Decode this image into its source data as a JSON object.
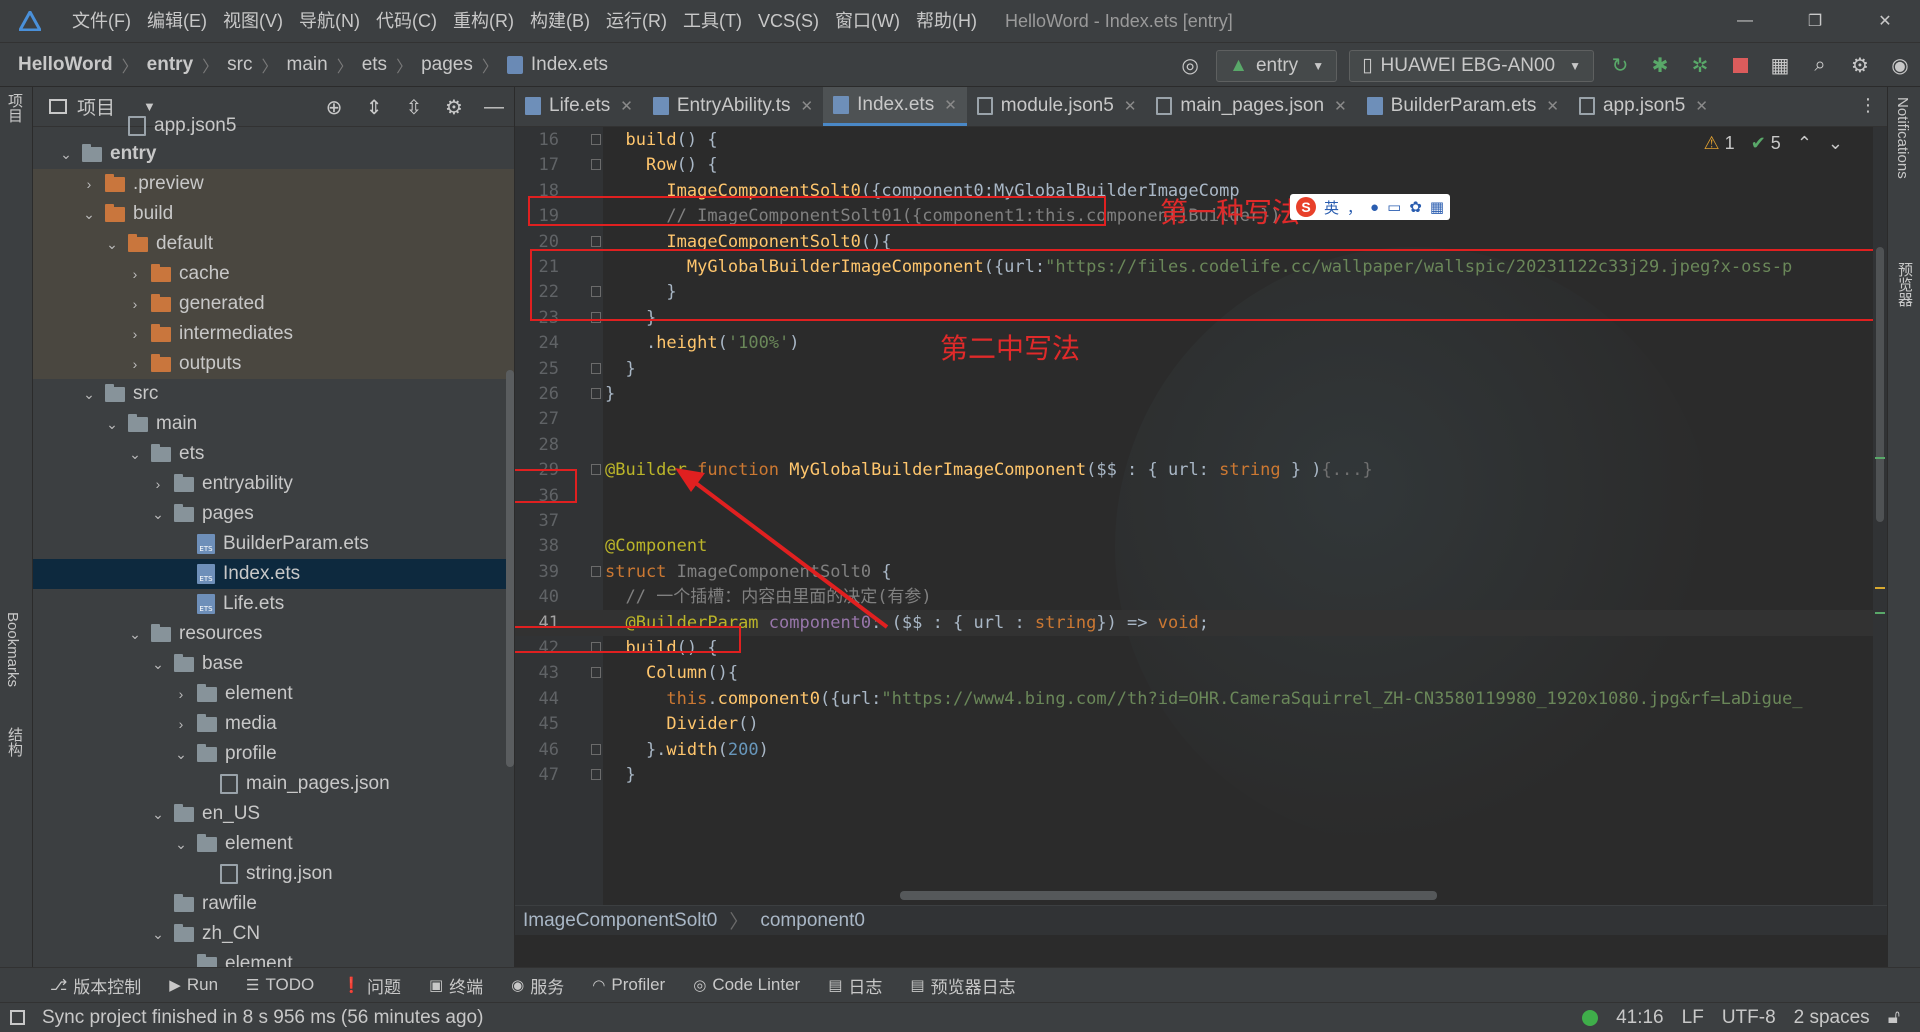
{
  "titlebar": {
    "menu": [
      "文件(F)",
      "编辑(E)",
      "视图(V)",
      "导航(N)",
      "代码(C)",
      "重构(R)",
      "构建(B)",
      "运行(R)",
      "工具(T)",
      "VCS(S)",
      "窗口(W)",
      "帮助(H)"
    ],
    "window_title": "HelloWord - Index.ets [entry]",
    "controls": {
      "minimize": "—",
      "restore": "❐",
      "close": "✕"
    }
  },
  "navbar": {
    "breadcrumbs": [
      "HelloWord",
      "entry",
      "src",
      "main",
      "ets",
      "pages",
      "Index.ets"
    ],
    "run_config": "entry",
    "device": "HUAWEI EBG-AN00"
  },
  "left_strip": {
    "project_label": "项目",
    "bookmarks_label": "Bookmarks",
    "structure_label": "结构"
  },
  "right_strip": {
    "notifications_label": "Notifications",
    "previewer_label": "预览器"
  },
  "project_panel": {
    "title": "项目",
    "tree": [
      {
        "label": "app.json5",
        "depth": 3,
        "arrow": "",
        "icon": "json",
        "style": ""
      },
      {
        "label": "entry",
        "depth": 1,
        "arrow": "⌄",
        "icon": "module",
        "style": "",
        "bold": true
      },
      {
        "label": ".preview",
        "depth": 2,
        "arrow": "›",
        "icon": "orange",
        "style": "excluded"
      },
      {
        "label": "build",
        "depth": 2,
        "arrow": "⌄",
        "icon": "orange",
        "style": "excluded"
      },
      {
        "label": "default",
        "depth": 3,
        "arrow": "⌄",
        "icon": "orange",
        "style": "excluded"
      },
      {
        "label": "cache",
        "depth": 4,
        "arrow": "›",
        "icon": "orange",
        "style": "excluded"
      },
      {
        "label": "generated",
        "depth": 4,
        "arrow": "›",
        "icon": "orange",
        "style": "excluded"
      },
      {
        "label": "intermediates",
        "depth": 4,
        "arrow": "›",
        "icon": "orange",
        "style": "excluded"
      },
      {
        "label": "outputs",
        "depth": 4,
        "arrow": "›",
        "icon": "orange",
        "style": "excluded"
      },
      {
        "label": "src",
        "depth": 2,
        "arrow": "⌄",
        "icon": "folder",
        "style": ""
      },
      {
        "label": "main",
        "depth": 3,
        "arrow": "⌄",
        "icon": "folder",
        "style": ""
      },
      {
        "label": "ets",
        "depth": 4,
        "arrow": "⌄",
        "icon": "folder",
        "style": ""
      },
      {
        "label": "entryability",
        "depth": 5,
        "arrow": "›",
        "icon": "folder",
        "style": ""
      },
      {
        "label": "pages",
        "depth": 5,
        "arrow": "⌄",
        "icon": "folder",
        "style": ""
      },
      {
        "label": "BuilderParam.ets",
        "depth": 6,
        "arrow": "",
        "icon": "ets",
        "style": ""
      },
      {
        "label": "Index.ets",
        "depth": 6,
        "arrow": "",
        "icon": "ets",
        "style": "selected"
      },
      {
        "label": "Life.ets",
        "depth": 6,
        "arrow": "",
        "icon": "ets",
        "style": ""
      },
      {
        "label": "resources",
        "depth": 4,
        "arrow": "⌄",
        "icon": "folder",
        "style": ""
      },
      {
        "label": "base",
        "depth": 5,
        "arrow": "⌄",
        "icon": "folder",
        "style": ""
      },
      {
        "label": "element",
        "depth": 6,
        "arrow": "›",
        "icon": "folder",
        "style": ""
      },
      {
        "label": "media",
        "depth": 6,
        "arrow": "›",
        "icon": "folder",
        "style": ""
      },
      {
        "label": "profile",
        "depth": 6,
        "arrow": "⌄",
        "icon": "folder",
        "style": ""
      },
      {
        "label": "main_pages.json",
        "depth": 7,
        "arrow": "",
        "icon": "json",
        "style": ""
      },
      {
        "label": "en_US",
        "depth": 5,
        "arrow": "⌄",
        "icon": "folder",
        "style": ""
      },
      {
        "label": "element",
        "depth": 6,
        "arrow": "⌄",
        "icon": "folder",
        "style": ""
      },
      {
        "label": "string.json",
        "depth": 7,
        "arrow": "",
        "icon": "json",
        "style": ""
      },
      {
        "label": "rawfile",
        "depth": 5,
        "arrow": "",
        "icon": "folder",
        "style": ""
      },
      {
        "label": "zh_CN",
        "depth": 5,
        "arrow": "⌄",
        "icon": "folder",
        "style": ""
      },
      {
        "label": "element",
        "depth": 6,
        "arrow": "",
        "icon": "folder",
        "style": ""
      }
    ]
  },
  "editor": {
    "tabs": [
      {
        "label": "Life.ets",
        "icon": "ets",
        "active": false
      },
      {
        "label": "EntryAbility.ts",
        "icon": "ets",
        "active": false
      },
      {
        "label": "Index.ets",
        "icon": "ets",
        "active": true
      },
      {
        "label": "module.json5",
        "icon": "json",
        "active": false
      },
      {
        "label": "main_pages.json",
        "icon": "json",
        "active": false
      },
      {
        "label": "BuilderParam.ets",
        "icon": "ets",
        "active": false
      },
      {
        "label": "app.json5",
        "icon": "json",
        "active": false
      }
    ],
    "inspection": {
      "warnings": "1",
      "ok": "5"
    },
    "lines": [
      {
        "n": "16",
        "fold": true,
        "current": false,
        "html": "  <span class=\"fn\">build</span>() {"
      },
      {
        "n": "17",
        "fold": true,
        "current": false,
        "html": "    <span class=\"fn\">Row</span>() {"
      },
      {
        "n": "18",
        "fold": false,
        "current": false,
        "html": "      <span class=\"fn\">ImageComponentSolt0</span>({component0:MyGlobalBuilderImageComp"
      },
      {
        "n": "19",
        "fold": false,
        "current": false,
        "html": "      <span class=\"com\">// ImageComponentSolt01({component1:this.component1Builder})</span>"
      },
      {
        "n": "20",
        "fold": true,
        "current": false,
        "html": "      <span class=\"fn\">ImageComponentSolt0</span>(){"
      },
      {
        "n": "21",
        "fold": false,
        "current": false,
        "html": "        <span class=\"fn\">MyGlobalBuilderImageComponent</span>({url:<span class=\"str\">\"https://files.codelife.cc/wallpaper/wallspic/20231122c33j29.jpeg?x-oss-p</span>"
      },
      {
        "n": "22",
        "fold": true,
        "current": false,
        "html": "      }"
      },
      {
        "n": "23",
        "fold": true,
        "current": false,
        "html": "    }"
      },
      {
        "n": "24",
        "fold": false,
        "current": false,
        "html": "    .<span class=\"fn\">height</span>(<span class=\"str\">'100%'</span>)"
      },
      {
        "n": "25",
        "fold": true,
        "current": false,
        "html": "  }"
      },
      {
        "n": "26",
        "fold": true,
        "current": false,
        "html": "}"
      },
      {
        "n": "27",
        "fold": false,
        "current": false,
        "html": ""
      },
      {
        "n": "28",
        "fold": false,
        "current": false,
        "html": ""
      },
      {
        "n": "29",
        "fold": true,
        "current": false,
        "html": "<span class=\"ann\">@Builder</span> <span class=\"kw\">function</span> <span class=\"fn\">MyGlobalBuilderImageComponent</span>($$ : { url: <span class=\"kw\">string</span> } )<span class=\"dim\">{...}</span>"
      },
      {
        "n": "36",
        "fold": false,
        "current": false,
        "html": ""
      },
      {
        "n": "37",
        "fold": false,
        "current": false,
        "html": ""
      },
      {
        "n": "38",
        "fold": false,
        "current": false,
        "html": "<span class=\"ann\">@Component</span>"
      },
      {
        "n": "39",
        "fold": true,
        "current": false,
        "html": "<span class=\"kw\">struct</span> <span class=\"struct-name\">ImageComponentSolt0</span> {"
      },
      {
        "n": "40",
        "fold": false,
        "current": false,
        "html": "  <span class=\"com\">// 一个插槽：内容由里面的决定(有参)</span>"
      },
      {
        "n": "41",
        "fold": false,
        "current": true,
        "html": "  <span class=\"ann\">@BuilderParam</span> <span class=\"typ\">component0</span>: ($$ : { url : <span class=\"kw\">string</span>}) => <span class=\"kw\">void</span>;"
      },
      {
        "n": "42",
        "fold": true,
        "current": false,
        "html": "  <span class=\"fn\">build</span>() {"
      },
      {
        "n": "43",
        "fold": true,
        "current": false,
        "html": "    <span class=\"fn\">Column</span>(){"
      },
      {
        "n": "44",
        "fold": false,
        "current": false,
        "html": "      <span class=\"kw\">this</span>.<span class=\"fn\">component0</span>({url:<span class=\"str\">\"https://www4.bing.com//th?id=OHR.CameraSquirrel_ZH-CN3580119980_1920x1080.jpg&rf=LaDigue_</span>"
      },
      {
        "n": "45",
        "fold": false,
        "current": false,
        "html": "      <span class=\"fn\">Divider</span>()"
      },
      {
        "n": "46",
        "fold": true,
        "current": false,
        "html": "    }.<span class=\"fn\">width</span>(<span class=\"num\">200</span>)"
      },
      {
        "n": "47",
        "fold": true,
        "current": false,
        "html": "  }"
      }
    ],
    "annotations": {
      "first_way": "第一种写法",
      "second_way": "第二中写法"
    },
    "ime": {
      "logo": "S",
      "lang": "英",
      "punct": "，"
    },
    "breadcrumb": [
      "ImageComponentSolt0",
      "component0"
    ]
  },
  "toolwindows": [
    {
      "icon": "⎇",
      "label": "版本控制"
    },
    {
      "icon": "▶",
      "label": "Run"
    },
    {
      "icon": "☰",
      "label": "TODO"
    },
    {
      "icon": "❗",
      "label": "问题"
    },
    {
      "icon": "▣",
      "label": "终端"
    },
    {
      "icon": "◉",
      "label": "服务"
    },
    {
      "icon": "◠",
      "label": "Profiler"
    },
    {
      "icon": "◎",
      "label": "Code Linter"
    },
    {
      "icon": "▤",
      "label": "日志"
    },
    {
      "icon": "▤",
      "label": "预览器日志"
    }
  ],
  "statusbar": {
    "message": "Sync project finished in 8 s 956 ms (56 minutes ago)",
    "position": "41:16",
    "line_ending": "LF",
    "encoding": "UTF-8",
    "indent": "2 spaces"
  }
}
